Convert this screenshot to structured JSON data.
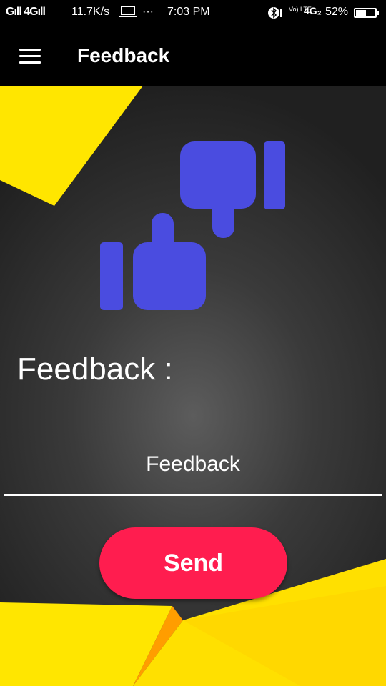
{
  "status_bar": {
    "signal_1": "Gıll 4Gıll",
    "net_speed": "11.7K/s",
    "laptop_icon": "laptop-icon",
    "more": "···",
    "time": "7:03 PM",
    "volte": "Vo) LTE",
    "network_2": "4G₂",
    "battery_percent": "52%",
    "battery_level": 0.52
  },
  "app_bar": {
    "menu_icon": "hamburger-menu-icon",
    "title": "Feedback"
  },
  "main": {
    "illustration_icon": "thumbs-up-down-icon",
    "feedback_label": "Feedback :",
    "feedback_input": {
      "placeholder": "Feedback",
      "value": ""
    },
    "send_label": "Send"
  },
  "colors": {
    "accent_yellow": "#ffe600",
    "thumb_blue": "#4a4ce0",
    "send_button": "#ff1d4f",
    "background_dark": "#2e2e2e"
  }
}
